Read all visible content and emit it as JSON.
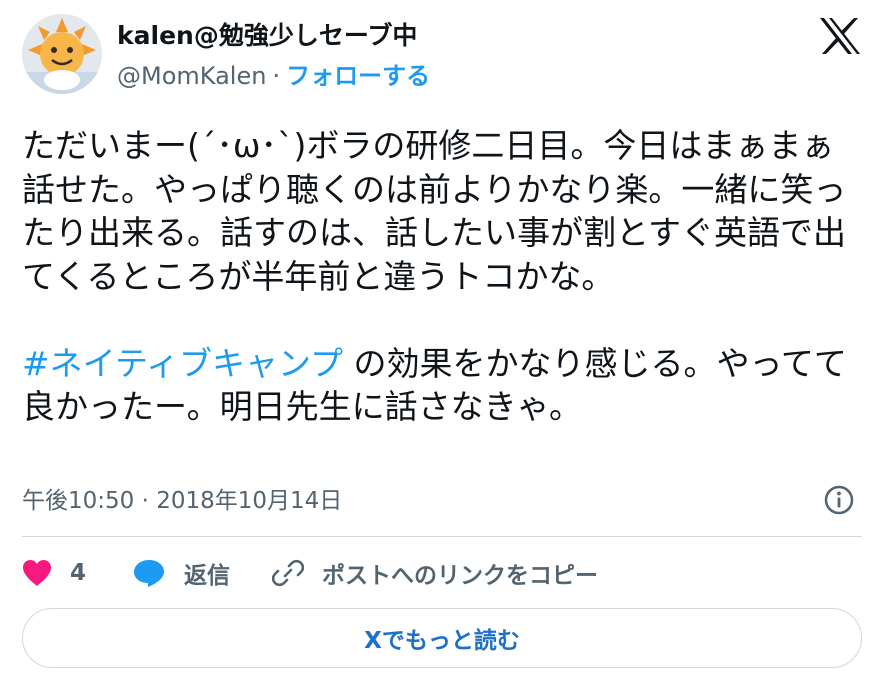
{
  "author": {
    "display_name": "kalen@勉強少しセーブ中",
    "handle": "@MomKalen",
    "separator": "·",
    "follow_label": "フォローする"
  },
  "tweet": {
    "text_before": "ただいまー(´･ω･`)ボラの研修二日目。今日はまぁまぁ話せた。やっぱり聴くのは前よりかなり楽。一緒に笑ったり出来る。話すのは、話したい事が割とすぐ英語で出てくるところが半年前と違うトコかな。\n\n",
    "hashtag": "#ネイティブキャンプ",
    "text_after": " の効果をかなり感じる。やってて良かったー。明日先生に話さなきゃ。",
    "timestamp": "午後10:50 · 2018年10月14日"
  },
  "actions": {
    "like_count": "4",
    "reply_label": "返信",
    "copy_link_label": "ポストへのリンクをコピー"
  },
  "read_more_label": "Xでもっと読む",
  "colors": {
    "accent": "#1d9bf0",
    "like": "#f91880",
    "text": "#0f1419",
    "secondary": "#536471"
  },
  "icons": [
    "x-logo-icon",
    "info-icon",
    "heart-icon",
    "reply-bubble-icon",
    "link-icon"
  ]
}
